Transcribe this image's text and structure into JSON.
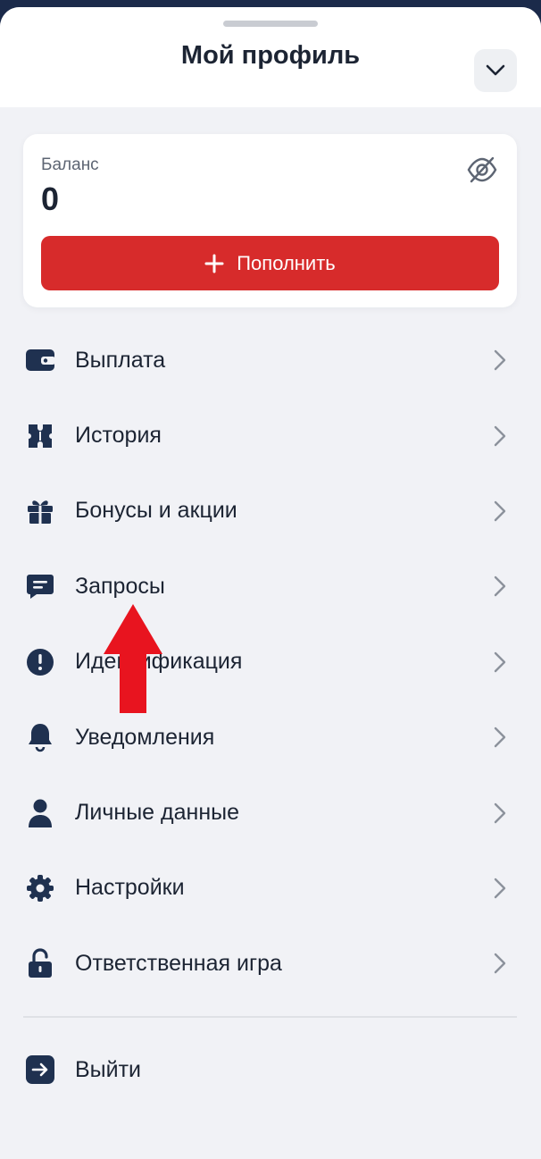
{
  "sheet": {
    "title": "Мой профиль",
    "collapse_icon": "chevron-down-icon"
  },
  "balance": {
    "label": "Баланс",
    "value": "0",
    "visibility_icon": "eye-off-icon",
    "topup_label": "Пополнить",
    "topup_icon": "plus-icon",
    "accent_color": "#d72b2b"
  },
  "menu": {
    "items": [
      {
        "label": "Выплата",
        "icon": "wallet-icon"
      },
      {
        "label": "История",
        "icon": "ticket-icon"
      },
      {
        "label": "Бонусы и акции",
        "icon": "gift-icon"
      },
      {
        "label": "Запросы",
        "icon": "message-icon"
      },
      {
        "label": "Идентификация",
        "icon": "alert-icon"
      },
      {
        "label": "Уведомления",
        "icon": "bell-icon"
      },
      {
        "label": "Личные данные",
        "icon": "user-icon"
      },
      {
        "label": "Настройки",
        "icon": "gear-icon"
      },
      {
        "label": "Ответственная игра",
        "icon": "unlock-icon"
      }
    ],
    "chevron_icon": "chevron-right-icon"
  },
  "logout": {
    "label": "Выйти",
    "icon": "logout-icon"
  },
  "annotation": {
    "icon": "red-arrow-up-icon",
    "color": "#e8141f"
  }
}
